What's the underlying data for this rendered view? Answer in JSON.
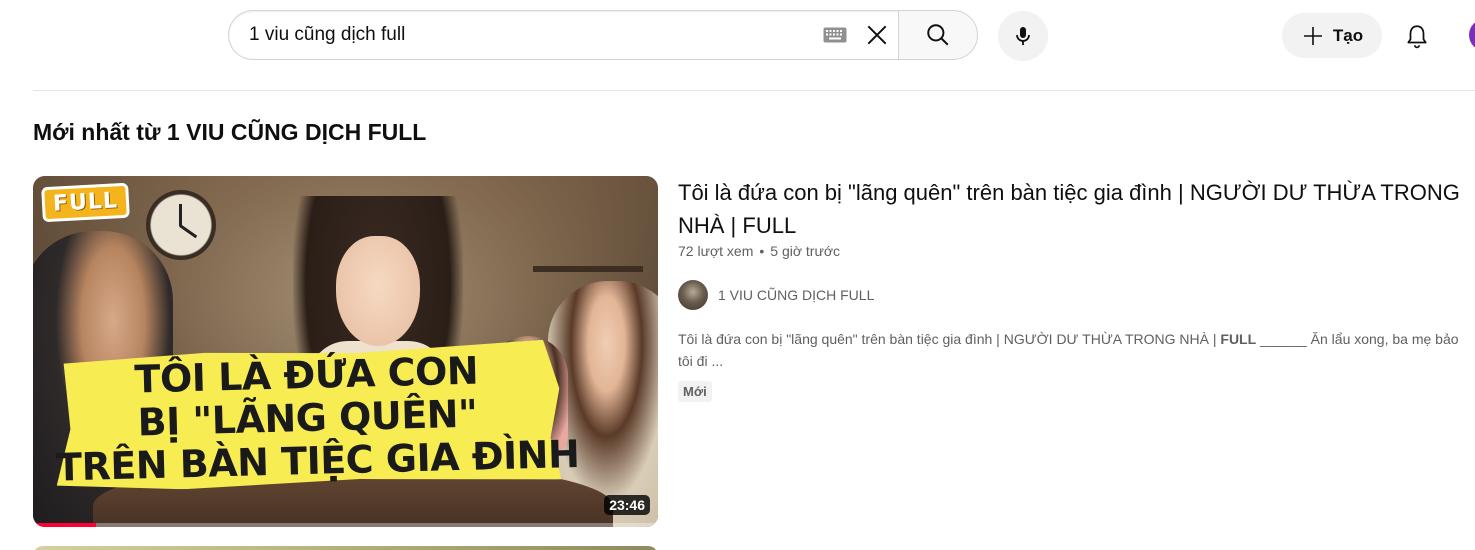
{
  "search": {
    "value": "1 viu cũng dịch full",
    "keyboard_icon": "keyboard-icon",
    "clear_icon": "close-icon",
    "search_icon": "search-icon",
    "mic_icon": "mic-icon"
  },
  "header": {
    "create_label": "Tạo",
    "create_icon": "plus-icon",
    "bell_icon": "bell-icon"
  },
  "section": {
    "title": "Mới nhất từ 1 VIU CŨNG DỊCH FULL"
  },
  "video": {
    "thumbnail": {
      "tag": "FULL",
      "line1": "TÔI LÀ ĐỨA CON",
      "line2": "BỊ \"LÃNG QUÊN\"",
      "line3": "TRÊN BÀN TIỆC GIA ĐÌNH"
    },
    "duration": "23:46",
    "progress_fraction": 0.1,
    "title": "Tôi là đứa con bị \"lãng quên\" trên bàn tiệc gia đình | NGƯỜI DƯ THỪA TRONG NHÀ | FULL",
    "views": "72 lượt xem",
    "separator": "•",
    "age": "5 giờ trước",
    "channel": "1 VIU CŨNG DỊCH FULL",
    "description_part1": "Tôi là đứa con bị \"lãng quên\" trên bàn tiệc gia đình | NGƯỜI DƯ THỪA TRONG NHÀ | ",
    "description_bold": "FULL",
    "description_part2": " ______ Ăn lẩu xong, ba mẹ bảo tôi đi ...",
    "badge": "Mới"
  },
  "colors": {
    "accent_red": "#ff0033",
    "banner_yellow": "#f7ec52",
    "secondary_text": "#606060"
  }
}
